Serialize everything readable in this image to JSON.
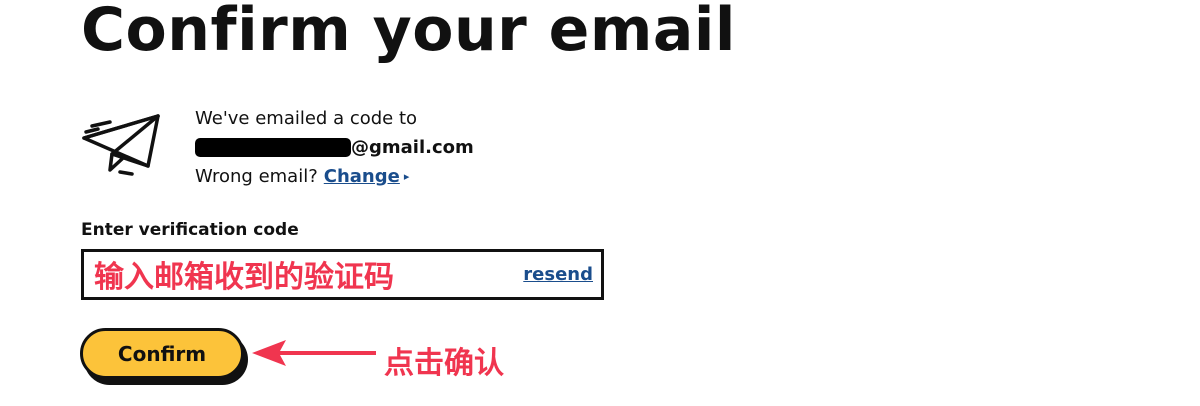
{
  "page": {
    "title": "Confirm your email"
  },
  "email_info": {
    "intro": "We've emailed a code to",
    "email_domain": "@gmail.com",
    "wrong_email": "Wrong email?",
    "change_label": "Change",
    "change_caret": "▸"
  },
  "verification": {
    "label": "Enter verification code",
    "value": "",
    "placeholder": "",
    "resend_label": "resend"
  },
  "actions": {
    "confirm_label": "Confirm"
  },
  "annotations": {
    "input_hint": "输入邮箱收到的验证码",
    "confirm_hint": "点击确认",
    "color": "#f0354f"
  },
  "theme": {
    "button_color": "#fcc33a",
    "link_color": "#1a4d8c",
    "text_color": "#111111"
  },
  "icons": {
    "plane": "paper-plane-icon",
    "arrow": "arrow-left-icon",
    "caret": "caret-right-icon"
  }
}
